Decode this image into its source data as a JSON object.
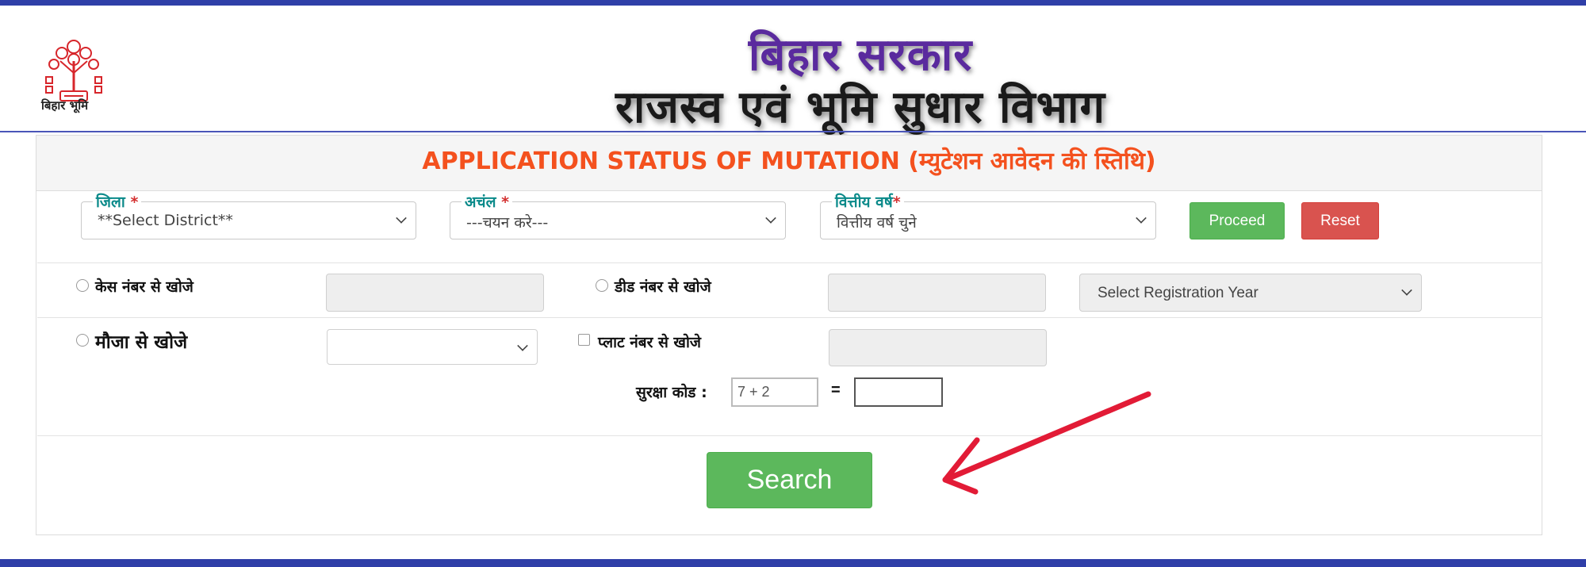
{
  "header": {
    "logo_text": "बिहार भूमि",
    "title_line1": "बिहार सरकार",
    "title_line2": "राजस्व एवं भूमि सुधार विभाग"
  },
  "panel": {
    "heading": "APPLICATION STATUS OF MUTATION (म्युटेशन आवेदन की स्तिथि)"
  },
  "filters": {
    "district_label": "जिला",
    "district_value": "**Select District**",
    "anchal_label": "अचंल",
    "anchal_value": "---चयन करे---",
    "year_label": "वित्तीय वर्ष",
    "year_value": "वित्तीय वर्ष चुने",
    "required_mark": "*",
    "proceed_label": "Proceed",
    "reset_label": "Reset"
  },
  "search_options": {
    "case_label": "केस नंबर से खोजे",
    "deed_label": "डीड नंबर से खोजे",
    "registration_year_value": "Select Registration Year",
    "mauja_label": "मौजा से खोजे",
    "plot_label": "प्लाट नंबर से खोजे"
  },
  "captcha": {
    "label": "सुरक्षा कोड :",
    "question": "7 + 2",
    "equals": "="
  },
  "search_label": "Search",
  "colors": {
    "brand_blue": "#2f3fa8",
    "heading_orange": "#f4511e",
    "success_green": "#5cb85c",
    "danger_red": "#d9534f",
    "annotation_arrow": "#e21b36"
  }
}
